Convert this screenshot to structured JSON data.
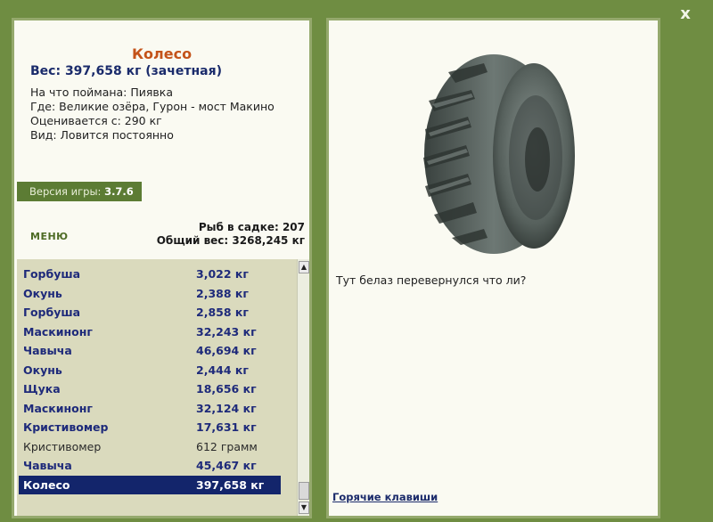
{
  "window": {
    "close_label": "x"
  },
  "catch": {
    "name": "Колесо",
    "weight": "Вес: 397,658 кг (зачетная)",
    "caught_on": "На что поймана: Пиявка",
    "location": "Где: Великие озёра, Гурон - мост Макино",
    "rated_from": "Оценивается с: 290 кг",
    "kind": "Вид: Ловится постоянно"
  },
  "version": {
    "label": "Версия игры:",
    "value": "3.7.6"
  },
  "menu": {
    "label": "МЕНЮ"
  },
  "stats": {
    "fish_count": "Рыб в садке: 207",
    "total_weight": "Общий вес: 3268,245 кг"
  },
  "fish_list": [
    {
      "name": "Горбуша",
      "weight": "3,022 кг",
      "style": "bold"
    },
    {
      "name": "Окунь",
      "weight": "2,388 кг",
      "style": "bold"
    },
    {
      "name": "Горбуша",
      "weight": "2,858 кг",
      "style": "bold"
    },
    {
      "name": "Маскинонг",
      "weight": "32,243 кг",
      "style": "bold"
    },
    {
      "name": "Чавыча",
      "weight": "46,694 кг",
      "style": "bold"
    },
    {
      "name": "Окунь",
      "weight": "2,444 кг",
      "style": "bold"
    },
    {
      "name": "Щука",
      "weight": "18,656 кг",
      "style": "bold"
    },
    {
      "name": "Маскинонг",
      "weight": "32,124 кг",
      "style": "bold"
    },
    {
      "name": "Кристивомер",
      "weight": "17,631 кг",
      "style": "bold"
    },
    {
      "name": "Кристивомер",
      "weight": "612 грамм",
      "style": "light"
    },
    {
      "name": "Чавыча",
      "weight": "45,467 кг",
      "style": "bold"
    },
    {
      "name": "Колесо",
      "weight": "397,658 кг",
      "style": "selected"
    }
  ],
  "details": {
    "comment": "Тут белаз перевернулся что ли?",
    "hotkeys_link": "Горячие клавиши",
    "image_icon": "tire-image"
  },
  "colors": {
    "frame": "#6f8d42",
    "panel": "#fafaf2",
    "title": "#c4531a",
    "list_text": "#1e2a7a",
    "selection": "#13256b"
  }
}
